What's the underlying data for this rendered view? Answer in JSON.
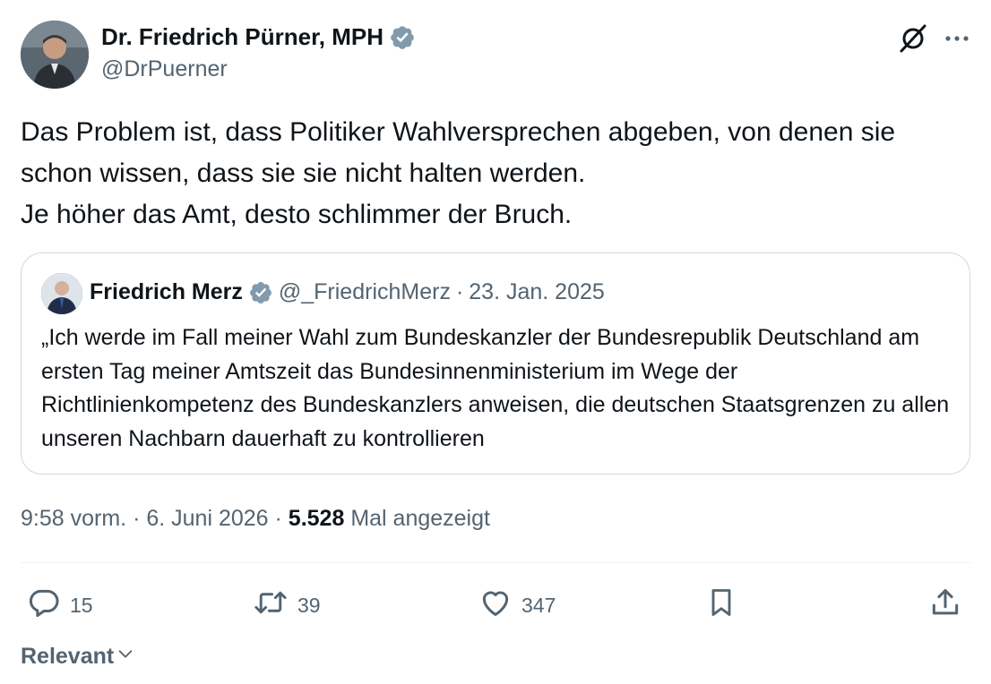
{
  "tweet": {
    "author": {
      "name": "Dr. Friedrich Pürner, MPH",
      "handle": "@DrPuerner"
    },
    "text": "Das Problem ist, dass Politiker Wahlversprechen abgeben, von denen sie\nschon wissen, dass sie sie nicht halten werden.\nJe höher das Amt, desto schlimmer der Bruch.",
    "quoted": {
      "name": "Friedrich Merz",
      "handle": "@_FriedrichMerz",
      "separator": "·",
      "date": "23. Jan. 2025",
      "text": "„Ich werde im Fall meiner Wahl zum Bundeskanzler der Bundesrepublik Deutschland am ersten Tag meiner Amtszeit das Bundesinnenministerium im Wege der Richtlinienkompetenz des Bundeskanzlers anweisen, die deutschen Staatsgrenzen zu allen unseren Nachbarn dauerhaft zu kontrollieren"
    },
    "meta": {
      "time": "9:58 vorm.",
      "sep1": "·",
      "date": "6. Juni 2026",
      "sep2": "·",
      "views": "5.528",
      "views_label": "Mal angezeigt"
    },
    "stats": {
      "replies": "15",
      "reposts": "39",
      "likes": "347"
    }
  },
  "sort": {
    "label": "Relevant"
  },
  "colors": {
    "verified": "#829aab",
    "text": "#0f1419",
    "muted": "#536471",
    "border": "#cfd9de"
  },
  "icons": [
    "grok-icon",
    "more-icon",
    "reply-icon",
    "repost-icon",
    "like-icon",
    "bookmark-icon",
    "share-icon",
    "chevron-down-icon",
    "verified-badge-icon"
  ]
}
